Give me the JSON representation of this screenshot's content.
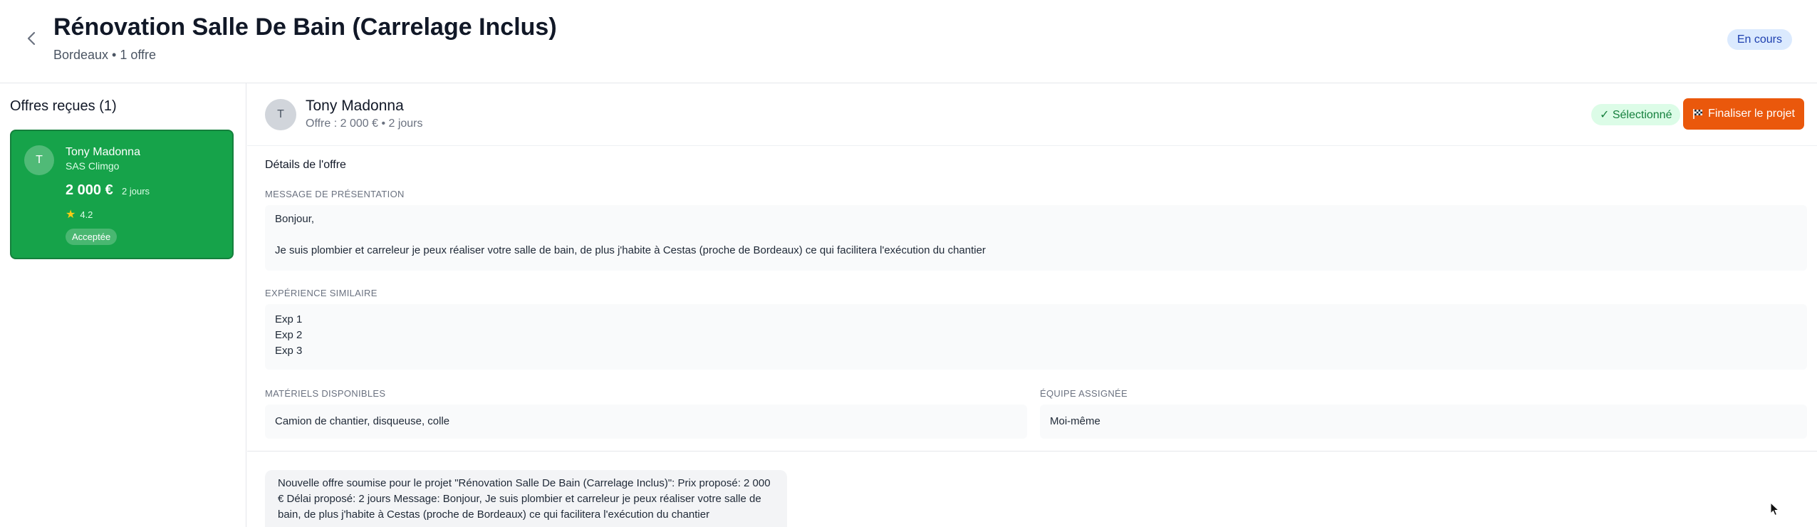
{
  "header": {
    "title": "Rénovation Salle De Bain (Carrelage Inclus)",
    "subtitle": "Bordeaux • 1 offre",
    "status": "En cours"
  },
  "sidebar": {
    "title": "Offres reçues (1)",
    "offers": [
      {
        "avatar_initial": "T",
        "name": "Tony Madonna",
        "company": "SAS Climgo",
        "price": "2 000 €",
        "delay": "2 jours",
        "rating": "4.2",
        "status": "Acceptée"
      }
    ]
  },
  "detail": {
    "avatar_initial": "T",
    "provider_name": "Tony Madonna",
    "offer_summary": "Offre : 2 000 € • 2 jours",
    "selected_label": "✓ Sélectionné",
    "finalize_label": "Finaliser le projet",
    "section_title": "Détails de l'offre",
    "presentation": {
      "label": "Message de présentation",
      "greeting": "Bonjour,",
      "body": "Je suis plombier et carreleur je peux réaliser votre salle de bain, de plus j'habite à Cestas (proche de Bordeaux) ce qui facilitera l'exécution du chantier"
    },
    "experience": {
      "label": "Expérience similaire",
      "items": [
        "Exp 1",
        "Exp 2",
        "Exp 3"
      ]
    },
    "materials": {
      "label": "Matériels disponibles",
      "value": "Camion de chantier, disqueuse, colle"
    },
    "team": {
      "label": "Équipe assignée",
      "value": "Moi-même"
    }
  },
  "message": {
    "text": "Nouvelle offre soumise pour le projet \"Rénovation Salle De Bain (Carrelage Inclus)\": Prix proposé: 2 000 € Délai proposé: 2 jours Message: Bonjour, Je suis plombier et carreleur je peux réaliser votre salle de bain, de plus j'habite à Cestas (proche de Bordeaux) ce qui facilitera l'exécution du chantier"
  },
  "icons": {
    "back": "chevron-left-icon",
    "star": "star-icon",
    "flag": "checkered-flag-icon",
    "cursor": "mouse-pointer-icon"
  },
  "colors": {
    "accent_green": "#16a34a",
    "finalize_orange": "#ea580c",
    "status_blue_bg": "#dbeafe",
    "selected_green_bg": "#dcfce7"
  }
}
